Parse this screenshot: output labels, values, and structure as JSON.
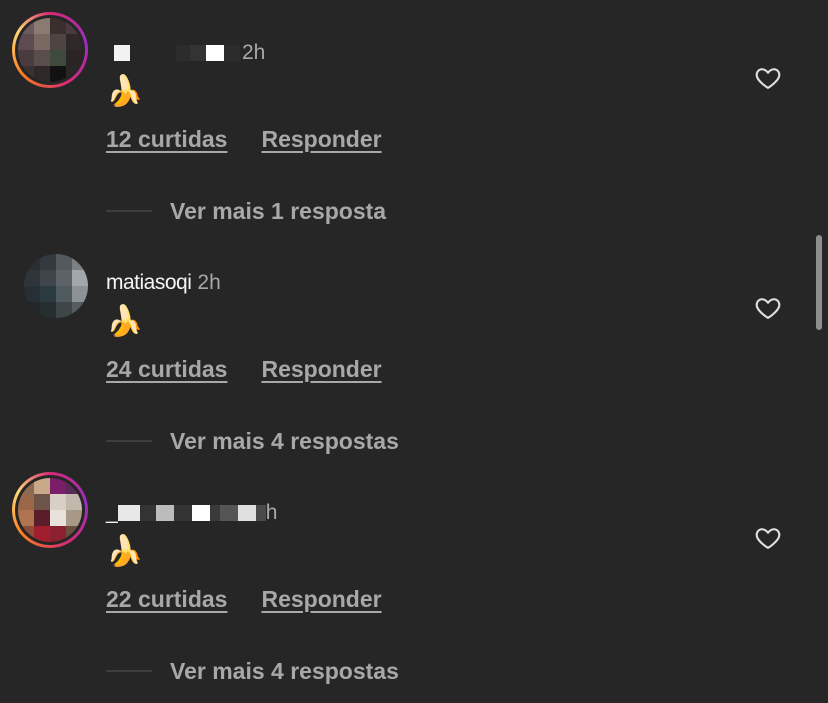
{
  "comments": [
    {
      "username": "",
      "time": "2h",
      "emoji": "🍌",
      "likes_label": "12 curtidas",
      "reply_label": "Responder",
      "more_replies": "Ver mais 1 resposta",
      "story_ring": true,
      "avatar_icon": "user-avatar-pixelated"
    },
    {
      "username": "matiasoqi",
      "time": "2h",
      "emoji": "🍌",
      "likes_label": "24 curtidas",
      "reply_label": "Responder",
      "more_replies": "Ver mais 4 respostas",
      "story_ring": false,
      "avatar_icon": "user-avatar-pixelated"
    },
    {
      "username": "_",
      "time": "h",
      "emoji": "🍌",
      "likes_label": "22 curtidas",
      "reply_label": "Responder",
      "more_replies": "Ver mais 4 respostas",
      "story_ring": true,
      "avatar_icon": "user-avatar-pixelated"
    }
  ],
  "icons": {
    "like": "heart-outline-icon"
  },
  "colors": {
    "background": "#262626",
    "secondary_text": "#a8a8a8",
    "reply_line": "#3d3d3d",
    "scrollbar": "#8e8e8e"
  }
}
